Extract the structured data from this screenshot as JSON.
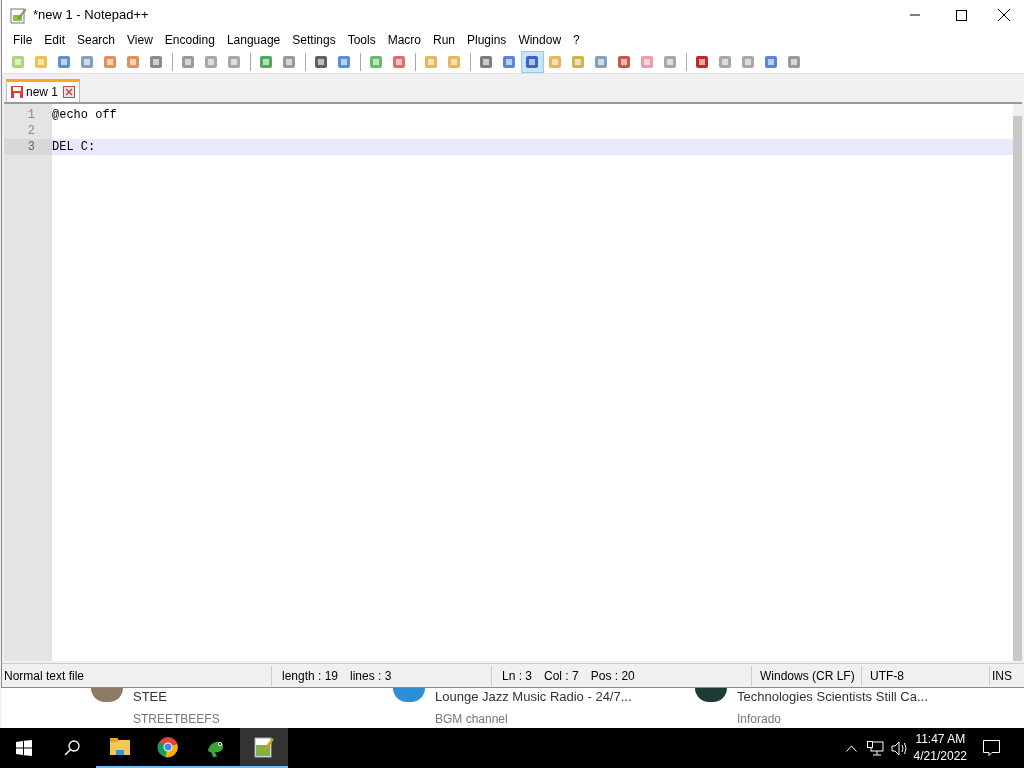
{
  "window": {
    "title": "*new 1 - Notepad++"
  },
  "menu": [
    "File",
    "Edit",
    "Search",
    "View",
    "Encoding",
    "Language",
    "Settings",
    "Tools",
    "Macro",
    "Run",
    "Plugins",
    "Window",
    "?"
  ],
  "toolbar": [
    {
      "selected": false
    },
    {
      "selected": false
    },
    {
      "selected": false
    },
    {
      "selected": false
    },
    {
      "selected": false
    },
    {
      "selected": false
    },
    {
      "selected": false
    },
    {
      "selected": false
    },
    {
      "selected": false
    },
    {
      "selected": false
    },
    {
      "selected": false
    },
    {
      "selected": false
    },
    {
      "selected": false
    },
    {
      "selected": false
    },
    {
      "selected": false
    },
    {
      "selected": false
    },
    {
      "selected": false
    },
    {
      "selected": false
    },
    {
      "selected": false
    },
    {
      "selected": false
    },
    {
      "selected": true
    },
    {
      "selected": false
    },
    {
      "selected": false
    },
    {
      "selected": false
    },
    {
      "selected": false
    },
    {
      "selected": false
    },
    {
      "selected": false
    },
    {
      "selected": false
    },
    {
      "selected": false
    },
    {
      "selected": false
    },
    {
      "selected": false
    },
    {
      "selected": false
    }
  ],
  "tabs": [
    {
      "label": "new 1",
      "selected": true
    }
  ],
  "editor": {
    "lines": [
      {
        "number": "1",
        "text": "@echo off",
        "current": false
      },
      {
        "number": "2",
        "current": false
      },
      {
        "number": "3",
        "text": "DEL C:",
        "current": true
      }
    ]
  },
  "status_bar": {
    "file_type": "Normal text file",
    "length": "length : 19",
    "lines": "lines : 3",
    "ln": "Ln : 3",
    "col": "Col : 7",
    "pos": "Pos : 20",
    "eol": "Windows (CR LF)",
    "encoding": "UTF-8",
    "mode": "INS"
  },
  "background_page": {
    "videos": [
      {
        "title": "STEE",
        "channel": "STREETBEEFS"
      },
      {
        "title": "Lounge Jazz Music Radio - 24/7...",
        "channel": "BGM channel"
      },
      {
        "title": "Technologies Scientists Still Ca...",
        "channel": "Inforado"
      }
    ]
  },
  "taskbar": {
    "apps": [
      {
        "selected": false
      },
      {
        "selected": false
      },
      {
        "selected": false
      },
      {
        "selected": true
      }
    ],
    "time": "11:47 AM",
    "date": "4/21/2022"
  }
}
